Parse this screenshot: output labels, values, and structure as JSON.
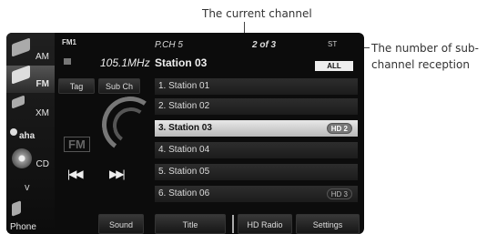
{
  "annotations": {
    "current_channel": "The current channel",
    "subchannel_reception": "The number of sub-channel reception"
  },
  "sources": [
    {
      "label": "AM",
      "icon": "am-radio-icon"
    },
    {
      "label": "FM",
      "icon": "fm-radio-icon",
      "active": true
    },
    {
      "label": "XM",
      "icon": "xm-satellite-icon"
    },
    {
      "label": "aha",
      "icon": "aha-icon"
    },
    {
      "label": "CD",
      "icon": "cd-disc-icon"
    },
    {
      "label": "v",
      "icon": "chevron-down-icon"
    },
    {
      "label": "Phone",
      "icon": "phone-icon"
    }
  ],
  "tuner": {
    "band": "FM1",
    "frequency": "105.1MHz",
    "tag_label": "Tag",
    "subch_label": "Sub Ch",
    "logo": "FM"
  },
  "channel": {
    "program": "P.CH 5",
    "of_count": "2 of 3",
    "stereo": "ST",
    "station": "Station 03",
    "filter": "ALL"
  },
  "stations": [
    {
      "label": "1. Station 01",
      "hd": ""
    },
    {
      "label": "2. Station 02",
      "hd": ""
    },
    {
      "label": "3. Station 03",
      "hd": "2",
      "selected": true
    },
    {
      "label": "4. Station 04",
      "hd": ""
    },
    {
      "label": "5. Station 05",
      "hd": ""
    },
    {
      "label": "6. Station 06",
      "hd": "3"
    }
  ],
  "bottom": {
    "sound": "Sound",
    "title": "Title",
    "hd_radio": "HD Radio",
    "settings": "Settings"
  },
  "colors": {
    "screen_bg": "#0c0c0c",
    "selected_row": "#d8d8d8",
    "annotation_text": "#333333"
  }
}
